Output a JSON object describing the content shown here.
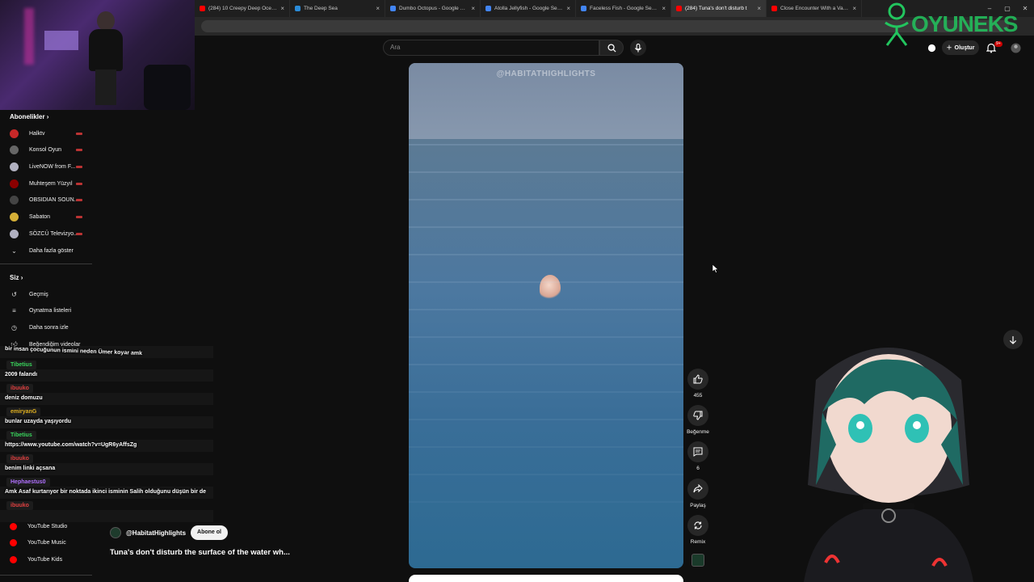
{
  "browser": {
    "tabs": [
      {
        "title": "(284) 10 Creepy Deep Ocean C",
        "favicon": "#ff0000",
        "active": false
      },
      {
        "title": "The Deep Sea",
        "favicon": "#2a8bd8",
        "active": false
      },
      {
        "title": "Dumbo Octopus - Google Searc",
        "favicon": "#4285f4",
        "active": false
      },
      {
        "title": "Atolla Jellyfish - Google Search",
        "favicon": "#4285f4",
        "active": false
      },
      {
        "title": "Faceless Fish - Google Search",
        "favicon": "#4285f4",
        "active": false
      },
      {
        "title": "(284) Tuna's don't disturb t",
        "favicon": "#ff0000",
        "active": true
      },
      {
        "title": "Close Encounter With a Vamp",
        "favicon": "#ff0000",
        "active": false
      }
    ],
    "window_controls": [
      "–",
      "▢",
      "✕"
    ]
  },
  "sidebar": {
    "subscriptions_title": "Abonelikler",
    "subscriptions": [
      {
        "label": "Halktv",
        "color": "#c62828"
      },
      {
        "label": "Konsol Oyun",
        "color": "#666666"
      },
      {
        "label": "LiveNOW from F...",
        "color": "#b0b0c0"
      },
      {
        "label": "Muhteşem Yüzyıl",
        "color": "#8b0000"
      },
      {
        "label": "OBSIDIAN SOUN...",
        "color": "#444444"
      },
      {
        "label": "Sabaton",
        "color": "#d4af37"
      },
      {
        "label": "SÖZCÜ Televizyo...",
        "color": "#b0b0c0"
      }
    ],
    "show_more": "Daha fazla göster",
    "you_title": "Siz",
    "you_items": [
      {
        "label": "Geçmiş",
        "icon": "history-icon"
      },
      {
        "label": "Oynatma listeleri",
        "icon": "playlist-icon"
      },
      {
        "label": "Daha sonra izle",
        "icon": "clock-icon"
      },
      {
        "label": "Beğendiğim videolar",
        "icon": "like-icon"
      }
    ],
    "more_from": [
      {
        "label": "YouTube Studio",
        "color": "#ff0000"
      },
      {
        "label": "YouTube Music",
        "color": "#ff0000"
      },
      {
        "label": "YouTube Kids",
        "color": "#ff0000"
      }
    ]
  },
  "chat": [
    {
      "user": "",
      "text": "bir insan çocuğunun ismini neden Ümer koyar amk"
    },
    {
      "user": "Tibetius",
      "user_color": "#38d45b",
      "text": "2009 falandı"
    },
    {
      "user": "ibuuko",
      "user_color": "#e04040",
      "text": "deniz domuzu"
    },
    {
      "user": "emiryanG",
      "user_color": "#e0b020",
      "text": "bunlar uzayda yaşıyordu"
    },
    {
      "user": "Tibetius",
      "user_color": "#38d45b",
      "text": "https://www.youtube.com/watch?v=UgR6yAffsZg"
    },
    {
      "user": "ibuuko",
      "user_color": "#e04040",
      "text": "benim linki açsana"
    },
    {
      "user": "Hephaestus0",
      "user_color": "#b070ff",
      "text": "Amk Asaf kurtarıyor bir noktada ikinci isminin Salih olduğunu düşün bir de"
    },
    {
      "user": "ibuuko",
      "user_color": "#e04040",
      "text": ""
    }
  ],
  "search": {
    "placeholder": "Ara"
  },
  "header": {
    "create_label": "Oluştur",
    "notifications_badge": "9+"
  },
  "overlay_logo": "OYUNEKS",
  "video": {
    "watermark": "@HABITATHIGHLIGHTS",
    "channel": "@HabitatHighlights",
    "subscribe_label": "Abone ol",
    "title": "Tuna's don't disturb the surface of the water wh..."
  },
  "actions": {
    "like_count": "455",
    "dislike_label": "Beğenme",
    "comment_count": "6",
    "share_label": "Paylaş",
    "remix_label": "Remix"
  }
}
